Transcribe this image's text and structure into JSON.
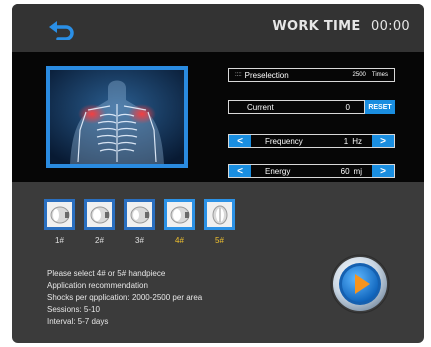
{
  "header": {
    "work_time_label": "WORK TIME",
    "work_time_value": "00:00"
  },
  "controls": {
    "preselection": {
      "dots": "::::",
      "label": "Preselection",
      "value": "2500",
      "unit": "Times"
    },
    "current": {
      "label": "Current",
      "value": "0",
      "reset_label": "RESET"
    },
    "frequency": {
      "label": "Frequency",
      "value": "1",
      "unit": "Hz"
    },
    "energy": {
      "label": "Energy",
      "value": "60",
      "unit": "mj"
    }
  },
  "handpieces": [
    {
      "label": "1#",
      "highlighted": false
    },
    {
      "label": "2#",
      "highlighted": false
    },
    {
      "label": "3#",
      "highlighted": false
    },
    {
      "label": "4#",
      "highlighted": true
    },
    {
      "label": "5#",
      "highlighted": true
    }
  ],
  "info": {
    "line1": "Please select 4# or 5# handpiece",
    "line2": "Application recommendation",
    "line3": "Shocks per qpplication:  2000-2500 per area",
    "line4": "Sessions:  5-10",
    "line5": "Interval: 5-7 days"
  },
  "colors": {
    "accent": "#1a8ee0",
    "highlight": "#f2c22e",
    "background": "#3b3b3b"
  },
  "icons": {
    "back": "back-arrow-icon",
    "play": "play-icon",
    "left": "chevron-left-icon",
    "right": "chevron-right-icon"
  }
}
